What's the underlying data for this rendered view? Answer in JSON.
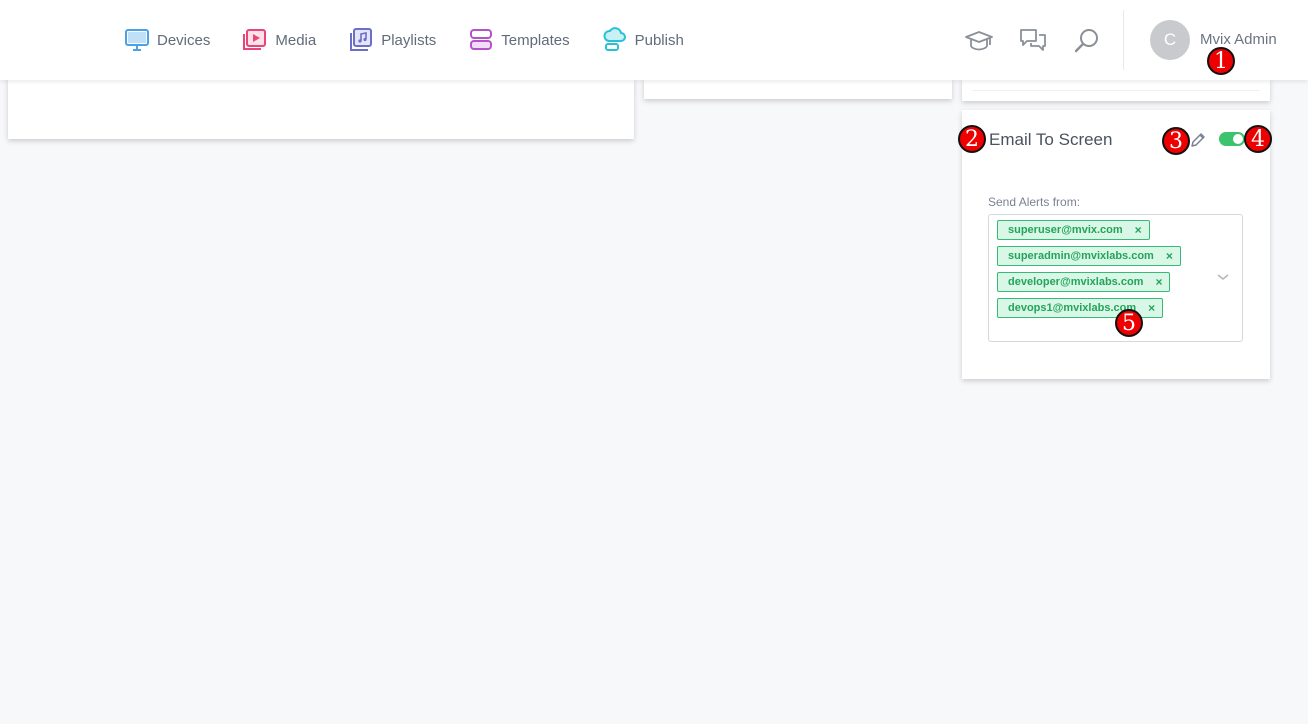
{
  "nav": {
    "items": [
      {
        "label": "Devices",
        "icon": "monitor-icon",
        "color": "#4aa3e8"
      },
      {
        "label": "Media",
        "icon": "media-play-icon",
        "color": "#e8457a"
      },
      {
        "label": "Playlists",
        "icon": "playlist-icon",
        "color": "#6a6fc9"
      },
      {
        "label": "Templates",
        "icon": "templates-icon",
        "color": "#b453c9"
      },
      {
        "label": "Publish",
        "icon": "cloud-publish-icon",
        "color": "#27c2d6"
      }
    ]
  },
  "header_tools": [
    "graduation-cap-icon",
    "chat-bubbles-icon",
    "search-icon"
  ],
  "user": {
    "avatar_initial": "C",
    "name": "Mvix Admin"
  },
  "email_card": {
    "title": "Email To Screen",
    "enabled": true,
    "field_label": "Send Alerts from:",
    "tags": [
      {
        "email": "superuser@mvix.com",
        "remove": "×"
      },
      {
        "email": "superadmin@mvixlabs.com",
        "remove": "×"
      },
      {
        "email": "developer@mvixlabs.com",
        "remove": "×"
      },
      {
        "email": "devops1@mvixlabs.com",
        "remove": "×"
      }
    ]
  },
  "markers": [
    "1",
    "2",
    "3",
    "4",
    "5"
  ],
  "colors": {
    "accent_green": "#3cc36d",
    "tag_bg": "#d8f7e6",
    "marker_red": "#ee0000"
  }
}
